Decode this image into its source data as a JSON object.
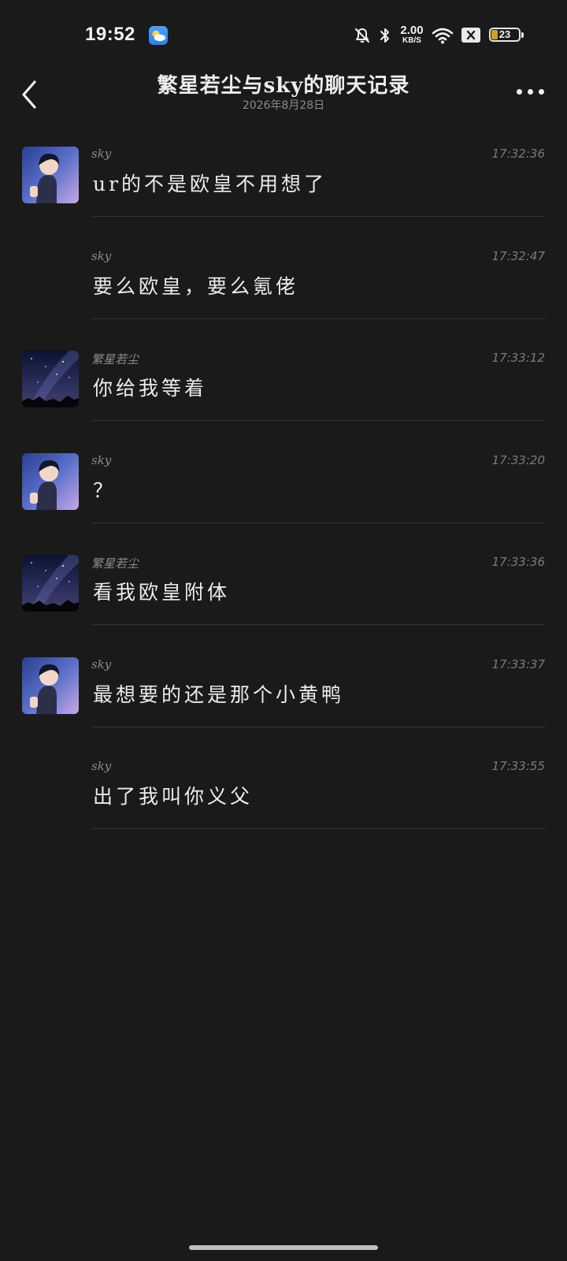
{
  "status_bar": {
    "time": "19:52",
    "net_speed_value": "2.00",
    "net_speed_unit": "KB/S",
    "battery_level": "23",
    "icons": [
      "weather-icon",
      "mute-icon",
      "bluetooth-icon",
      "wifi-icon",
      "no-sim-icon",
      "battery-icon"
    ]
  },
  "header": {
    "title": "繁星若尘与sky的聊天记录",
    "subtitle": "2026年8月28日",
    "back_icon": "chevron-left-icon",
    "more_icon": "more-dots-icon"
  },
  "messages": [
    {
      "sender": "sky",
      "time": "17:32:36",
      "text": "ur的不是欧皇不用想了",
      "avatar": "sky-avatar"
    },
    {
      "sender": "sky",
      "time": "17:32:47",
      "text": "要么欧皇，要么氪佬",
      "avatar": ""
    },
    {
      "sender": "繁星若尘",
      "time": "17:33:12",
      "text": "你给我等着",
      "avatar": "starry-avatar"
    },
    {
      "sender": "sky",
      "time": "17:33:20",
      "text": "？",
      "avatar": "sky-avatar"
    },
    {
      "sender": "繁星若尘",
      "time": "17:33:36",
      "text": "看我欧皇附体",
      "avatar": "starry-avatar"
    },
    {
      "sender": "sky",
      "time": "17:33:37",
      "text": "最想要的还是那个小黄鸭",
      "avatar": "sky-avatar"
    },
    {
      "sender": "sky",
      "time": "17:33:55",
      "text": "出了我叫你义父",
      "avatar": ""
    }
  ],
  "colors": {
    "background": "#1a1a1a",
    "text_primary": "#ececec",
    "text_secondary": "#8c8c8c",
    "divider": "#333333",
    "battery_fill": "#c9a227"
  }
}
